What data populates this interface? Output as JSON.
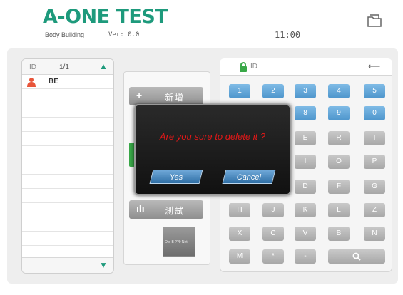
{
  "header": {
    "brand": "A-ONE TEST",
    "subtitle": "Body Building",
    "version": "Ver: 0.0",
    "clock": "11:00",
    "folder_icon": "folder-icon"
  },
  "list": {
    "id_label": "ID",
    "page": "1/1",
    "up_icon": "chevron-up-icon",
    "down_icon": "chevron-down-icon",
    "items": [
      {
        "name": "BE",
        "icon": "user-icon"
      }
    ]
  },
  "actions": {
    "add_label": "新增",
    "test_label": "測試",
    "thumb_label": "Oto B ??9 Net"
  },
  "keypad": {
    "id_label": "ID",
    "lock_icon": "lock-icon",
    "back_icon": "backspace-arrow-icon",
    "rows": [
      [
        "1",
        "2",
        "3",
        "4",
        "5"
      ],
      [
        "8",
        "9",
        "0"
      ],
      [
        "E",
        "R",
        "T"
      ],
      [
        "I",
        "O",
        "P"
      ],
      [
        "D",
        "F",
        "G"
      ],
      [
        "H",
        "J",
        "K",
        "L",
        "Z"
      ],
      [
        "X",
        "C",
        "V",
        "B",
        "N"
      ],
      [
        "M",
        "*",
        "-"
      ]
    ],
    "search_icon": "search-icon"
  },
  "dialog": {
    "message": "Are you sure to delete it ?",
    "yes": "Yes",
    "cancel": "Cancel"
  },
  "colors": {
    "brand": "#1e9a7c",
    "key_blue": "#5aa0d6",
    "alert_red": "#e31818"
  }
}
